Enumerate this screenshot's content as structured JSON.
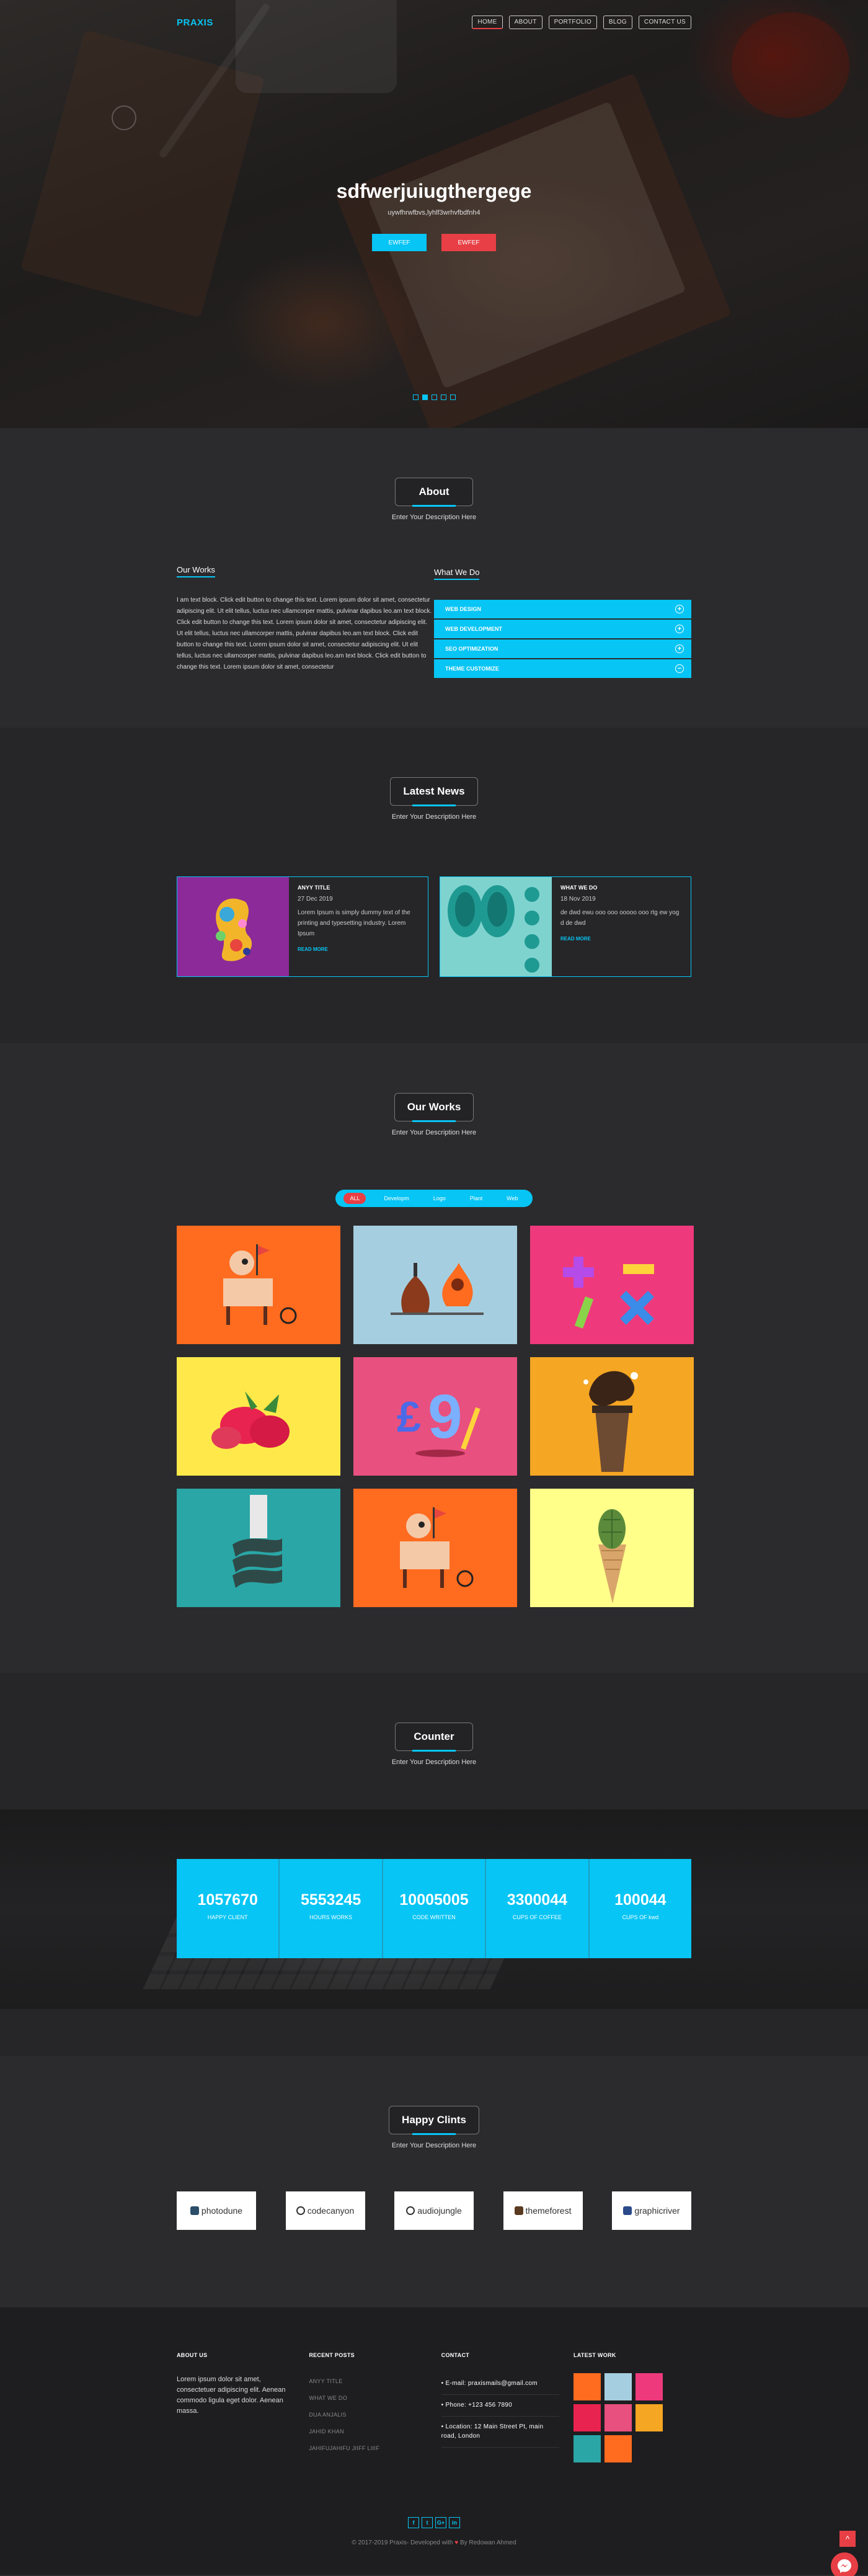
{
  "colors": {
    "accent": "#07c5f5",
    "red": "#e73f45",
    "bg": "#2b2b2d"
  },
  "brand": {
    "name": "PRAXIS"
  },
  "nav": [
    "HOME",
    "ABOUT",
    "PORTFOLIO",
    "BLOG",
    "CONTACT US"
  ],
  "hero": {
    "title": "sdfwerjuiugthergege",
    "subtitle": "uywfhrwfbvs,lyhlf3wrhvfbdfnh4",
    "btn1": "EWFEF",
    "btn2": "EWFEF",
    "slides_total": 5,
    "slide_active": 2
  },
  "about": {
    "title": "About",
    "desc": "Enter Your Description Here",
    "left_title": "Our Works",
    "text": "I am text block. Click edit button to change this text. Lorem ipsum dolor sit amet, consectetur adipiscing elit. Ut elit tellus, luctus nec ullamcorper mattis, pulvinar dapibus leo.am text block. Click edit button to change this text. Lorem ipsum dolor sit amet, consectetur adipiscing elit. Ut elit tellus, luctus nec ullamcorper mattis, pulvinar dapibus leo.am text block. Click edit button to change this text. Lorem ipsum dolor sit amet, consectetur adipiscing elit. Ut elit tellus, luctus nec ullamcorper mattis, pulvinar dapibus leo.am text block. Click edit button to change this text. Lorem ipsum dolor sit amet, consectetur",
    "right_title": "What We Do",
    "accordion": [
      "WEB DESIGN",
      "WEB DEVELOPMENT",
      "SEO OPTIMIZATION",
      "THEME CUSTOMIZE"
    ],
    "accordion_icons": [
      "plus-icon",
      "plus-icon",
      "plus-icon",
      "minus-icon"
    ]
  },
  "news": {
    "title": "Latest News",
    "desc": "Enter Your Description Here",
    "cards": [
      {
        "title": "ANYY TITLE",
        "date": "27 Dec 2019",
        "text": "Lorem Ipsum is simply dummy text of the printing and typesetting industry. Lorem Ipsum",
        "more": "READ MORE"
      },
      {
        "title": "WHAT WE DO",
        "date": "18 Nov 2019",
        "text": "de dwd ewu ooo ooo ooooo ooo rtg ew yog d de dwd",
        "more": "READ MORE"
      }
    ]
  },
  "works": {
    "title": "Our Works",
    "desc": "Enter Your Description Here",
    "filters": [
      "ALL",
      "Developm",
      "Logo",
      "Plant",
      "Web"
    ]
  },
  "counter": {
    "title": "Counter",
    "desc": "Enter Your Description Here",
    "items": [
      {
        "num": "1057670",
        "label": "HAPPY CLIENT"
      },
      {
        "num": "5553245",
        "label": "HOURS WORKS"
      },
      {
        "num": "10005005",
        "label": "CODE WRITTEN"
      },
      {
        "num": "3300044",
        "label": "CUPS OF COFFEE"
      },
      {
        "num": "100044",
        "label": "CUPS OF kwd"
      }
    ]
  },
  "clients": {
    "title": "Happy Clints",
    "desc": "Enter Your Description Here",
    "logos": [
      "photodune",
      "codecanyon",
      "audiojungle",
      "themeforest",
      "graphicriver"
    ]
  },
  "footer": {
    "about_title": "ABOUT US",
    "about_text": "Lorem ipsum dolor sit amet, consectetuer adipiscing elit. Aenean commodo ligula eget dolor. Aenean massa.",
    "recent_title": "RECENT POSTS",
    "recent": [
      "ANYY TITLE",
      "WHAT WE DO",
      "DUA ANJALIS",
      "JAHID KHAN",
      "JAHIFUJAHIFU JIIFF LIIIF"
    ],
    "contact_title": "CONTACT",
    "contact": [
      "E-mail: praxismails@gmail.com",
      "Phone: +123 456 7890",
      "Location: 12 Main Street Pt, main road, London"
    ],
    "latest_title": "LATEST WORK",
    "social": [
      "f",
      "t",
      "G+",
      "in"
    ],
    "copyright_pre": "© 2017-2019 Praxis- Developed with",
    "copyright_post": "By Redowan Ahmed",
    "to_top": "^"
  }
}
